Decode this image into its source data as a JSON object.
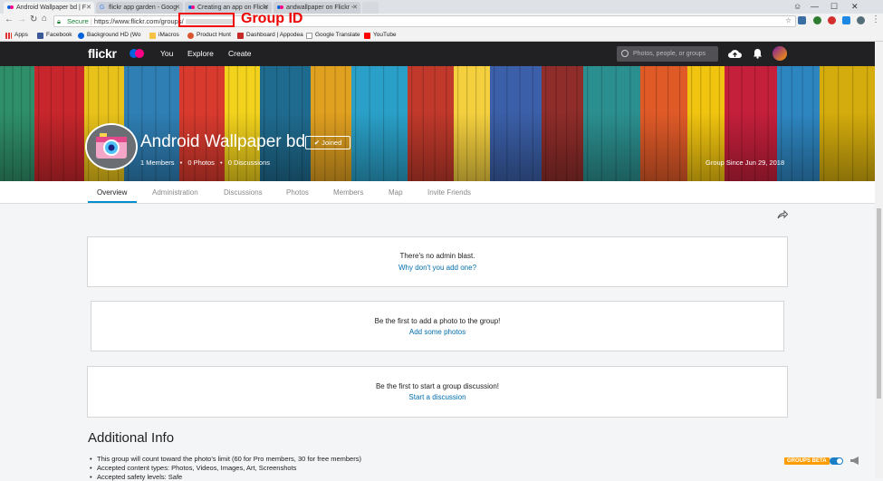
{
  "browser": {
    "tabs": [
      {
        "label": "Android Wallpaper bd | F"
      },
      {
        "label": "flickr app garden - Goog"
      },
      {
        "label": "Creating an app on Flickr"
      },
      {
        "label": "andwallpaper on Flickr -"
      }
    ],
    "secure_label": "Secure",
    "url": "https://www.flickr.com/groups/",
    "callout_label": "Group ID",
    "bookmarks": [
      "Apps",
      "Facebook",
      "Background HD (Wo",
      "iMacros",
      "Product Hunt",
      "Dashboard | Appodea",
      "Google Translate",
      "YouTube"
    ]
  },
  "flickr_nav": {
    "logo": "flickr",
    "you": "You",
    "explore": "Explore",
    "create": "Create",
    "search_placeholder": "Photos, people, or groups"
  },
  "group": {
    "title": "Android Wallpaper bd",
    "joined_label": "✔ Joined",
    "members": "1 Members",
    "photos": "0 Photos",
    "discussions": "0 Discussions",
    "since": "Group Since Jun 29, 2018"
  },
  "subnav": [
    "Overview",
    "Administration",
    "Discussions",
    "Photos",
    "Members",
    "Map",
    "Invite Friends"
  ],
  "panels": {
    "blast": {
      "line1": "There's no admin blast.",
      "line2": "Why don't you add one?"
    },
    "photos": {
      "line1": "Be the first to add a photo to the group!",
      "line2": "Add some photos"
    },
    "discussion": {
      "line1": "Be the first to start a group discussion!",
      "line2": "Start a discussion"
    }
  },
  "additional_info": {
    "heading": "Additional Info",
    "items": [
      "This group will count toward the photo's limit (60 for Pro members, 30 for free members)",
      "Accepted content types: Photos, Videos, Images, Art, Screenshots",
      "Accepted safety levels: Safe"
    ]
  },
  "groups_beta": "GROUPS BETA",
  "colors": {
    "flickr_blue": "#0063dc",
    "flickr_pink": "#ff0084",
    "link": "#006dac",
    "accent": "#008ecf"
  }
}
